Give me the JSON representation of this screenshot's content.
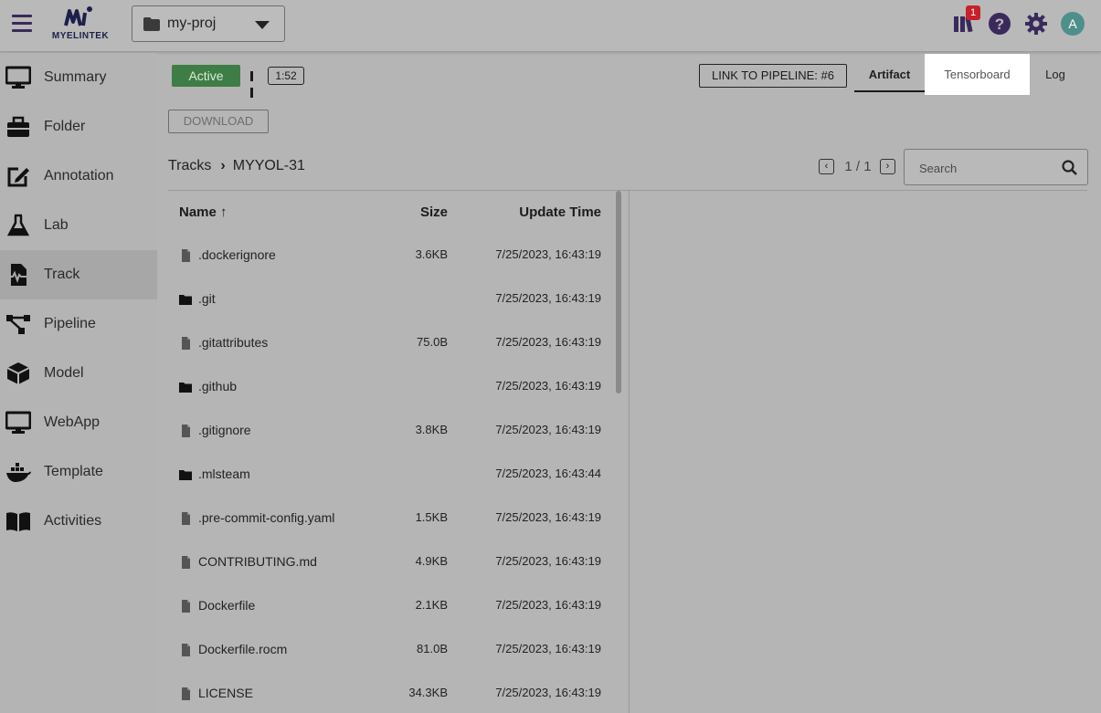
{
  "header": {
    "logo_text": "MYELINTEK",
    "project_name": "my-proj",
    "notification_count": "1",
    "avatar_initial": "A"
  },
  "sidebar": {
    "items": [
      {
        "label": "Summary",
        "icon": "monitor-icon"
      },
      {
        "label": "Folder",
        "icon": "toolbox-icon"
      },
      {
        "label": "Annotation",
        "icon": "edit-icon"
      },
      {
        "label": "Lab",
        "icon": "flask-icon"
      },
      {
        "label": "Track",
        "icon": "track-file-icon",
        "active": true
      },
      {
        "label": "Pipeline",
        "icon": "pipeline-icon"
      },
      {
        "label": "Model",
        "icon": "cube-icon"
      },
      {
        "label": "WebApp",
        "icon": "monitor-icon"
      },
      {
        "label": "Template",
        "icon": "docker-icon"
      },
      {
        "label": "Activities",
        "icon": "book-icon"
      }
    ]
  },
  "toolbar": {
    "status": "Active",
    "elapsed": "1:52",
    "pipeline_link": "LINK TO PIPELINE: #6",
    "download_label": "DOWNLOAD"
  },
  "tabs": [
    {
      "label": "Artifact",
      "active": true
    },
    {
      "label": "Tensorboard"
    },
    {
      "label": "Log"
    }
  ],
  "breadcrumb": {
    "root": "Tracks",
    "current": "MYYOL-31"
  },
  "pager": {
    "text": "1 / 1"
  },
  "search": {
    "placeholder": "Search"
  },
  "table": {
    "columns": {
      "name": "Name",
      "size": "Size",
      "time": "Update Time"
    },
    "rows": [
      {
        "type": "file",
        "name": ".dockerignore",
        "size": "3.6KB",
        "time": "7/25/2023, 16:43:19"
      },
      {
        "type": "folder",
        "name": ".git",
        "size": "",
        "time": "7/25/2023, 16:43:19"
      },
      {
        "type": "file",
        "name": ".gitattributes",
        "size": "75.0B",
        "time": "7/25/2023, 16:43:19"
      },
      {
        "type": "folder",
        "name": ".github",
        "size": "",
        "time": "7/25/2023, 16:43:19"
      },
      {
        "type": "file",
        "name": ".gitignore",
        "size": "3.8KB",
        "time": "7/25/2023, 16:43:19"
      },
      {
        "type": "folder",
        "name": ".mlsteam",
        "size": "",
        "time": "7/25/2023, 16:43:44"
      },
      {
        "type": "file",
        "name": ".pre-commit-config.yaml",
        "size": "1.5KB",
        "time": "7/25/2023, 16:43:19"
      },
      {
        "type": "file",
        "name": "CONTRIBUTING.md",
        "size": "4.9KB",
        "time": "7/25/2023, 16:43:19"
      },
      {
        "type": "file",
        "name": "Dockerfile",
        "size": "2.1KB",
        "time": "7/25/2023, 16:43:19"
      },
      {
        "type": "file",
        "name": "Dockerfile.rocm",
        "size": "81.0B",
        "time": "7/25/2023, 16:43:19"
      },
      {
        "type": "file",
        "name": "LICENSE",
        "size": "34.3KB",
        "time": "7/25/2023, 16:43:19"
      }
    ]
  }
}
